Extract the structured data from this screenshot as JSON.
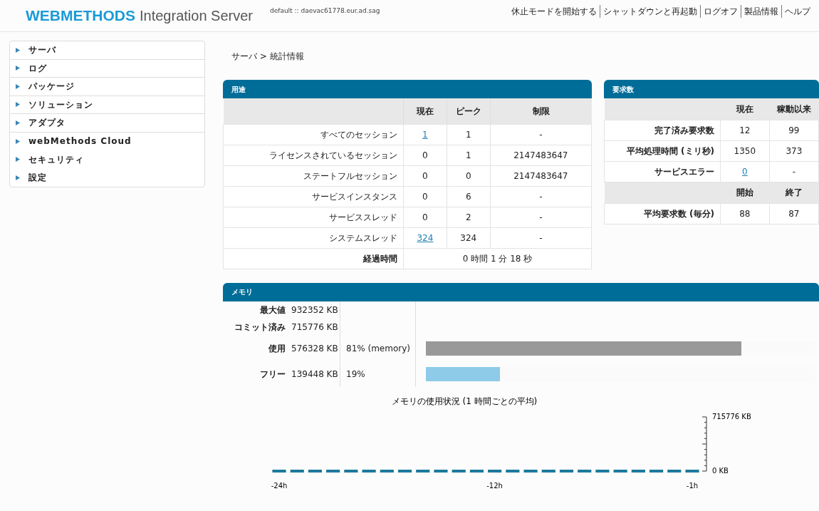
{
  "header": {
    "brand": "WEBMETHODS",
    "product": "Integration Server",
    "server": "default :: daevac61778.eur.ad.sag",
    "links": [
      "休止モードを開始する",
      "シャットダウンと再起動",
      "ログオフ",
      "製品情報",
      "ヘルプ"
    ]
  },
  "sidebar": {
    "items": [
      {
        "label": "サーバ"
      },
      {
        "label": "ログ"
      },
      {
        "label": "パッケージ"
      },
      {
        "label": "ソリューション"
      },
      {
        "label": "アダプタ"
      },
      {
        "label": "webMethods Cloud"
      },
      {
        "label": "セキュリティ"
      },
      {
        "label": "設定"
      }
    ]
  },
  "breadcrumb": "サーバ > 統計情報",
  "usage": {
    "title": "用途",
    "columns": [
      "現在",
      "ピーク",
      "制限"
    ],
    "rows": [
      {
        "label": "すべてのセッション",
        "cells": [
          {
            "text": "1",
            "link": true
          },
          {
            "text": "1",
            "link": false
          },
          {
            "text": "-",
            "link": false
          }
        ]
      },
      {
        "label": "ライセンスされているセッション",
        "cells": [
          {
            "text": "0",
            "link": false
          },
          {
            "text": "1",
            "link": false
          },
          {
            "text": "2147483647",
            "link": false
          }
        ]
      },
      {
        "label": "ステートフルセッション",
        "cells": [
          {
            "text": "0",
            "link": false
          },
          {
            "text": "0",
            "link": false
          },
          {
            "text": "2147483647",
            "link": false
          }
        ]
      },
      {
        "label": "サービスインスタンス",
        "cells": [
          {
            "text": "0",
            "link": false
          },
          {
            "text": "6",
            "link": false
          },
          {
            "text": "-",
            "link": false
          }
        ]
      },
      {
        "label": "サービススレッド",
        "cells": [
          {
            "text": "0",
            "link": false
          },
          {
            "text": "2",
            "link": false
          },
          {
            "text": "-",
            "link": false
          }
        ]
      },
      {
        "label": "システムスレッド",
        "cells": [
          {
            "text": "324",
            "link": true
          },
          {
            "text": "324",
            "link": false
          },
          {
            "text": "-",
            "link": false
          }
        ]
      }
    ],
    "elapsed": {
      "label": "経過時間",
      "value": "0 時間 1 分 18 秒"
    }
  },
  "requests": {
    "title": "要求数",
    "columns": [
      "現在",
      "稼動以来"
    ],
    "rows": [
      {
        "label": "完了済み要求数",
        "cells": [
          {
            "text": "12",
            "link": false
          },
          {
            "text": "99",
            "link": false
          }
        ]
      },
      {
        "label": "平均処理時間 (ミリ秒)",
        "cells": [
          {
            "text": "1350",
            "link": false
          },
          {
            "text": "373",
            "link": false
          }
        ]
      },
      {
        "label": "サービスエラー",
        "cells": [
          {
            "text": "0",
            "link": true
          },
          {
            "text": "-",
            "link": false
          }
        ]
      }
    ],
    "columns2": [
      "開始",
      "終了"
    ],
    "rows2": [
      {
        "label": "平均要求数 (毎分)",
        "cells": [
          {
            "text": "88",
            "link": false
          },
          {
            "text": "87",
            "link": false
          }
        ]
      }
    ]
  },
  "memory": {
    "title": "メモリ",
    "rows": [
      {
        "label": "最大値",
        "value": "932352 KB"
      },
      {
        "label": "コミット済み",
        "value": "715776 KB"
      },
      {
        "label": "使用",
        "value": "576328 KB",
        "percent": "81% (memory)",
        "level": 0.81,
        "color": "#999999"
      },
      {
        "label": "フリー",
        "value": "139448 KB",
        "percent": "19%",
        "level": 0.19,
        "color": "#8ecbe9"
      }
    ],
    "chart_data": {
      "type": "line",
      "title": "メモリの使用状況 (1 時間ごとの平均)",
      "x": [
        -24,
        -23,
        -22,
        -21,
        -20,
        -19,
        -18,
        -17,
        -16,
        -15,
        -14,
        -13,
        -12,
        -11,
        -10,
        -9,
        -8,
        -7,
        -6,
        -5,
        -4,
        -3,
        -2,
        -1
      ],
      "series": [
        {
          "color": "#1c7a9c",
          "line_style": "dashed",
          "values": [
            0,
            0,
            0,
            0,
            0,
            0,
            0,
            0,
            0,
            0,
            0,
            0,
            0,
            0,
            0,
            0,
            0,
            0,
            0,
            0,
            0,
            0,
            0,
            0
          ]
        }
      ],
      "xlim": [
        -24,
        -1
      ],
      "ylim": [
        0,
        715776
      ],
      "xticks": [
        {
          "value": -24,
          "label": "-24h"
        },
        {
          "value": -12,
          "label": "-12h"
        },
        {
          "value": -1,
          "label": "-1h"
        }
      ],
      "yticks": [
        {
          "value": 0,
          "label": "0 KB"
        },
        {
          "value": 715776,
          "label": "715776 KB"
        }
      ]
    }
  }
}
